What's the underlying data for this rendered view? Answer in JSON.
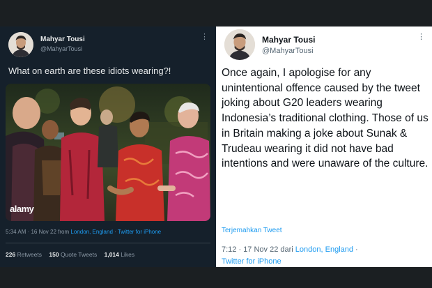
{
  "left_tweet": {
    "author_name": "Mahyar Tousi",
    "author_handle": "@MahyarTousi",
    "more_icon": "⋮",
    "text": "What on earth are these idiots wearing?!",
    "image_watermark": "alamy",
    "time": "5:34 AM · 16 Nov 22 from",
    "location": "London, England",
    "sep": " · ",
    "client": "Twitter for iPhone",
    "retweets_count": "226",
    "retweets_label": "Retweets",
    "quote_count": "150",
    "quote_label": "Quote Tweets",
    "likes_count": "1,014",
    "likes_label": "Likes"
  },
  "right_tweet": {
    "author_name": "Mahyar Tousi",
    "author_handle": "@MahyarTousi",
    "more_icon": "⋮",
    "text": "Once again, I apologise for any unintentional offence caused by the tweet joking about G20 leaders wearing Indonesia’s traditional clothing. Those of us in Britain making a joke about Sunak & Trudeau wearing it did not have bad intentions and were unaware of the culture.",
    "translate_label": "Terjemahkan Tweet",
    "time": "7:12 · 17 Nov 22 dari",
    "location": "London, England",
    "sep": " · ",
    "client": "Twitter for iPhone"
  },
  "colors": {
    "dark_bg": "#15202b",
    "light_bg": "#ffffff",
    "link_blue": "#1d9bf0",
    "page_bg": "#1b1f22"
  }
}
